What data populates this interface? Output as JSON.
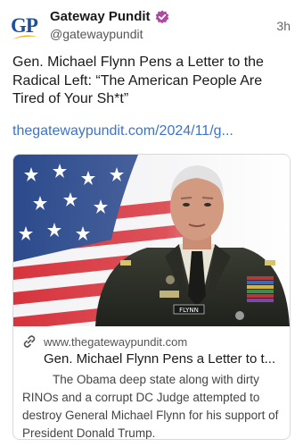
{
  "account": {
    "avatar_letters": "GP",
    "display_name": "Gateway Pundit",
    "handle": "@gatewaypundit",
    "time": "3h"
  },
  "post": {
    "text": "Gen. Michael Flynn Pens a Letter to the Radical Left: “The American People Are Tired of Your Sh*t”",
    "link_text": "thegatewaypundit.com/2024/11/g..."
  },
  "card": {
    "domain": "www.thegatewaypundit.com",
    "title": "Gen. Michael Flynn Pens a Letter to t...",
    "description": "The Obama deep state along with dirty RINOs and a corrupt DC Judge attempted to destroy General Michael Flynn for his support of President Donald Trump.",
    "name_tag": "FLYNN"
  },
  "colors": {
    "brand_blue": "#1d4f9b",
    "brand_gold": "#f2b21b",
    "verified_purple": "#b04a9f",
    "link_blue": "#3b74c9"
  },
  "icons": {
    "verified": "verified-badge-icon",
    "link": "link-icon"
  }
}
